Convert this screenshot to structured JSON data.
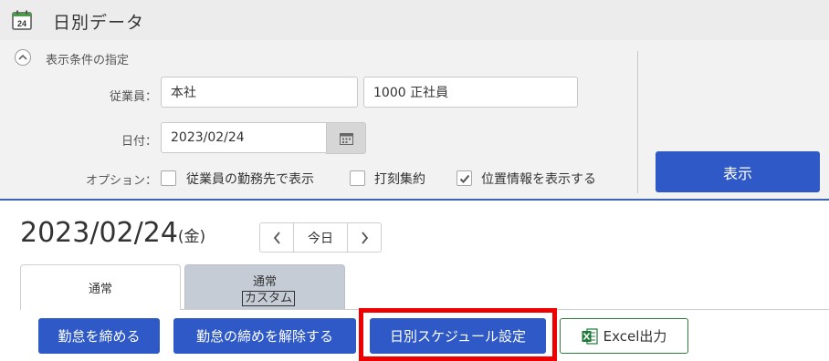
{
  "header": {
    "title": "日別データ",
    "icon": "calendar-24-icon",
    "icon_text": "24"
  },
  "conditions": {
    "title": "表示条件の指定",
    "employee_label": "従業員：",
    "employee_org": "本社",
    "employee_name": "1000 正社員",
    "date_label": "日付：",
    "date_value": "2023/02/24",
    "option_label": "オプション：",
    "options": [
      {
        "label": "従業員の勤務先で表示",
        "checked": false
      },
      {
        "label": "打刻集約",
        "checked": false
      },
      {
        "label": "位置情報を表示する",
        "checked": true
      }
    ],
    "show_button": "表示"
  },
  "date_header": {
    "date": "2023/02/24",
    "dow": "(金)",
    "today_label": "今日"
  },
  "tabs": [
    {
      "label": "通常",
      "active": true
    },
    {
      "line1": "通常",
      "line2": "カスタム",
      "active": false
    }
  ],
  "actions": {
    "close_label": "勤怠を締める",
    "unclose_label": "勤怠の締めを解除する",
    "schedule_label": "日別スケジュール設定",
    "excel_label": "Excel出力"
  },
  "colors": {
    "primary": "#2e59c6",
    "highlight": "#ee0000",
    "excel_green": "#1d7a3a"
  }
}
